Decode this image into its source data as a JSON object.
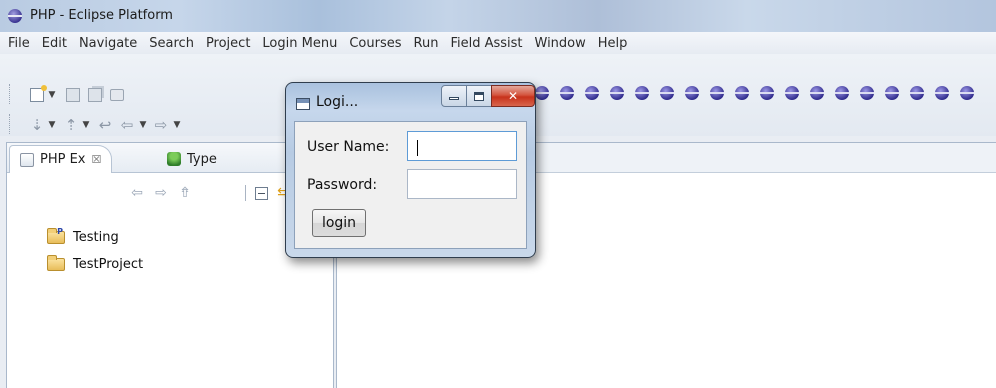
{
  "window": {
    "title": "PHP - Eclipse Platform"
  },
  "menubar": {
    "items": [
      "File",
      "Edit",
      "Navigate",
      "Search",
      "Project",
      "Login Menu",
      "Courses",
      "Run",
      "Field Assist",
      "Window",
      "Help"
    ]
  },
  "left_view": {
    "tabs": [
      {
        "label": "PHP Ex",
        "icon": "hierarchy-icon",
        "close": "☒"
      },
      {
        "label": "Type",
        "icon": "type-hierarchy-icon"
      }
    ],
    "tree": [
      {
        "label": "Testing",
        "icon": "php-project-folder-icon"
      },
      {
        "label": "TestProject",
        "icon": "folder-icon"
      }
    ]
  },
  "dialog": {
    "title": "Logi...",
    "username_label": "User Name:",
    "username_value": "",
    "password_label": "Password:",
    "password_value": "",
    "login_button": "login"
  }
}
